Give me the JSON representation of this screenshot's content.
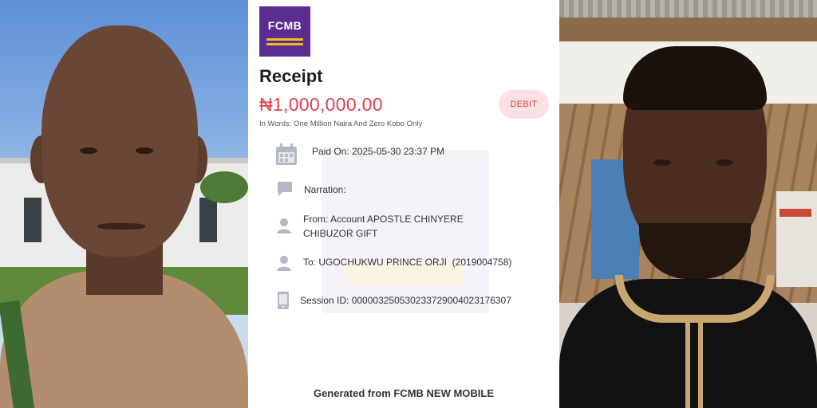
{
  "receipt": {
    "logo_text": "FCMB",
    "title": "Receipt",
    "amount": "₦1,000,000.00",
    "badge": "DEBIT",
    "amount_in_words": "In Words: One Million Naira And Zero Kobo Only",
    "rows": [
      {
        "icon": "calendar-icon",
        "lines": [
          "Paid On: 2025-05-30 23:37 PM"
        ]
      },
      {
        "icon": "chat-bubble-icon",
        "lines": [
          "Narration:"
        ]
      },
      {
        "icon": "person-icon",
        "lines": [
          "From: Account APOSTLE CHINYERE",
          "CHIBUZOR GIFT"
        ]
      },
      {
        "icon": "person-icon",
        "lines": [
          "To: UGOCHUKWU PRINCE ORJI  (2019004758)"
        ]
      },
      {
        "icon": "phone-icon",
        "lines": [
          "Session ID: 000003250530233729004023176307"
        ]
      }
    ],
    "footer": "Generated from FCMB NEW MOBILE"
  },
  "colors": {
    "brand_purple": "#5c2d91",
    "brand_yellow": "#f6b819",
    "amount_red": "#e0404c",
    "badge_bg": "#fbe1e3",
    "icon_grey": "#b4b8c2"
  }
}
